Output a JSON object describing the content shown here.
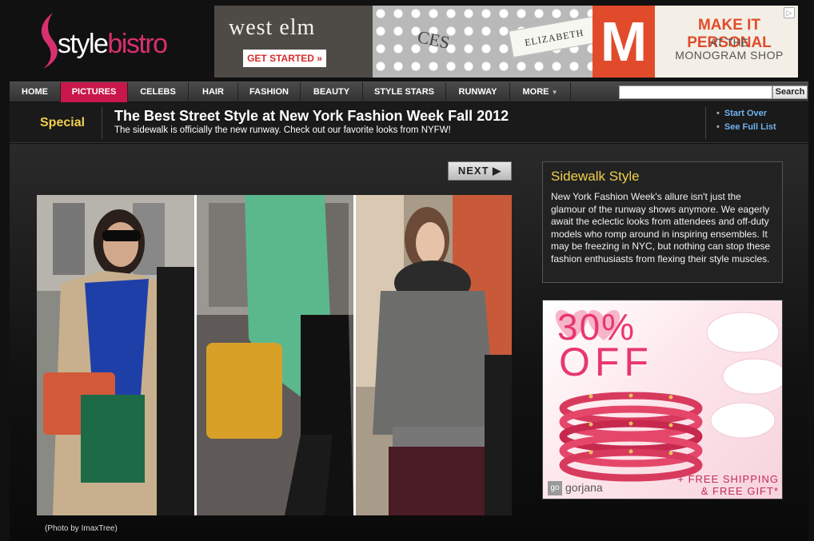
{
  "logo": {
    "part1": "style",
    "part2": "bistro"
  },
  "banner": {
    "westelm": "west elm",
    "get_started": "GET STARTED »",
    "initials": "CES",
    "name_tag": "ELIZABETH",
    "big_letter": "M",
    "make_it_personal": "MAKE IT PERSONAL",
    "at_the": "AT THE",
    "monogram_shop": "MONOGRAM SHOP",
    "ad_icon": "▷"
  },
  "nav": {
    "items": [
      {
        "label": "HOME"
      },
      {
        "label": "PICTURES"
      },
      {
        "label": "CELEBS"
      },
      {
        "label": "HAIR"
      },
      {
        "label": "FASHION"
      },
      {
        "label": "BEAUTY"
      },
      {
        "label": "STYLE STARS"
      },
      {
        "label": "RUNWAY"
      },
      {
        "label": "MORE"
      }
    ],
    "active_index": 1,
    "more_arrow": "▼",
    "search_placeholder": "",
    "search_button": "Search"
  },
  "special": {
    "label": "Special",
    "title": "The Best Street Style at New York Fashion Week Fall 2012",
    "subtitle": "The sidewalk is officially the new runway. Check out our favorite looks from NYFW!",
    "links": [
      "Start Over",
      "See Full List"
    ]
  },
  "gallery": {
    "next_label": "NEXT",
    "next_icon": "▶",
    "caption": "(Photo by ImaxTree)"
  },
  "info": {
    "title": "Sidewalk Style",
    "body": "New York Fashion Week's allure isn't just the glamour of the runway shows anymore. We eagerly await the eclectic looks from attendees and off-duty models who romp around in inspiring ensembles. It may be freezing in NYC, but nothing can stop these fashion enthusiasts from flexing their style muscles."
  },
  "ad": {
    "percent": "30%",
    "off": "OFF",
    "brand_mark": "go",
    "brand": "gorjana",
    "free_line1": "+ FREE SHIPPING",
    "free_line2": "& FREE GIFT*"
  },
  "colors": {
    "accent_pink": "#c8174a",
    "special_yellow": "#f0cf4c",
    "link_blue": "#6fb3ef"
  }
}
